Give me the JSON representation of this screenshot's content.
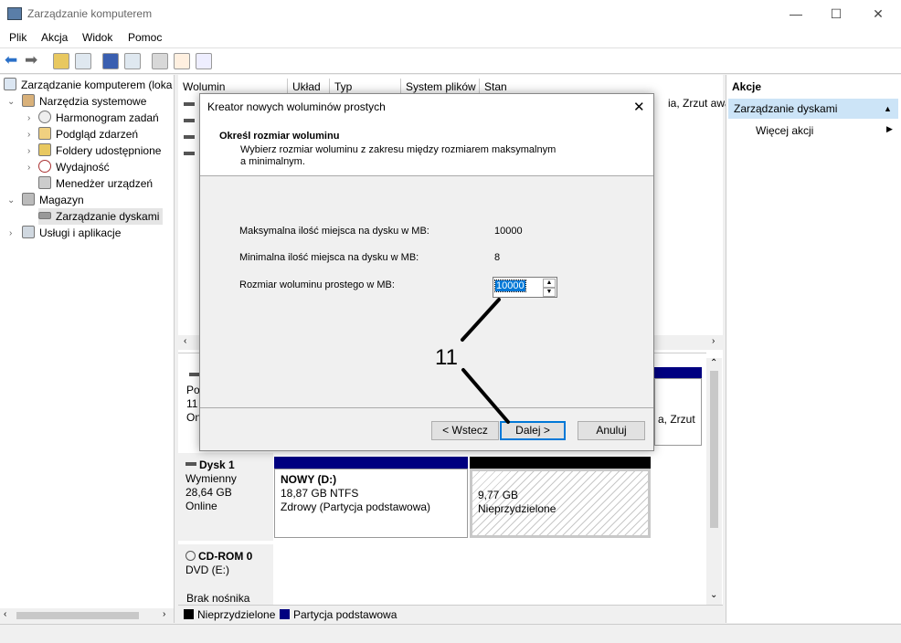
{
  "window": {
    "title": "Zarządzanie komputerem",
    "minimize": "—",
    "maximize": "☐",
    "close": "✕"
  },
  "menu": [
    "Plik",
    "Akcja",
    "Widok",
    "Pomoc"
  ],
  "tree": {
    "root": "Zarządzanie komputerem (loka",
    "system_tools": "Narzędzia systemowe",
    "task_scheduler": "Harmonogram zadań",
    "event_viewer": "Podgląd zdarzeń",
    "shared_folders": "Foldery udostępnione",
    "performance": "Wydajność",
    "device_manager": "Menedżer urządzeń",
    "storage": "Magazyn",
    "disk_mgmt": "Zarządzanie dyskami",
    "services": "Usługi i aplikacje"
  },
  "columns": [
    "Wolumin",
    "Układ",
    "Typ",
    "System plików",
    "Stan"
  ],
  "row_partial": "ia, Zrzut awar",
  "disk0": {
    "short1": "Po",
    "short2": "11",
    "short3": "On",
    "partial": "a, Zrzut"
  },
  "disk1": {
    "name": "Dysk 1",
    "type": "Wymienny",
    "size": "28,64 GB",
    "status": "Online"
  },
  "part_nowy": {
    "name": "NOWY  (D:)",
    "size": "18,87 GB NTFS",
    "status": "Zdrowy (Partycja podstawowa)"
  },
  "part_unalloc": {
    "size": "9,77 GB",
    "status": "Nieprzydzielone"
  },
  "cdrom": {
    "name": "CD-ROM 0",
    "drive": "DVD (E:)",
    "media": "Brak nośnika"
  },
  "legend": {
    "unalloc": "Nieprzydzielone",
    "primary": "Partycja podstawowa"
  },
  "actions": {
    "title": "Akcje",
    "section": "Zarządzanie dyskami",
    "more": "Więcej akcji"
  },
  "dialog": {
    "title": "Kreator nowych woluminów prostych",
    "heading": "Określ rozmiar woluminu",
    "subheading": "Wybierz rozmiar woluminu z zakresu między rozmiarem maksymalnym a minimalnym.",
    "max_label": "Maksymalna ilość miejsca na dysku w MB:",
    "max_value": "10000",
    "min_label": "Minimalna ilość miejsca na dysku w MB:",
    "min_value": "8",
    "size_label": "Rozmiar woluminu prostego w MB:",
    "size_value": "10000",
    "back": "< Wstecz",
    "next": "Dalej >",
    "cancel": "Anuluj"
  },
  "annotation": "11",
  "colors": {
    "primary_partition": "#000080",
    "unallocated": "#000000",
    "selection": "#cce4f7"
  }
}
